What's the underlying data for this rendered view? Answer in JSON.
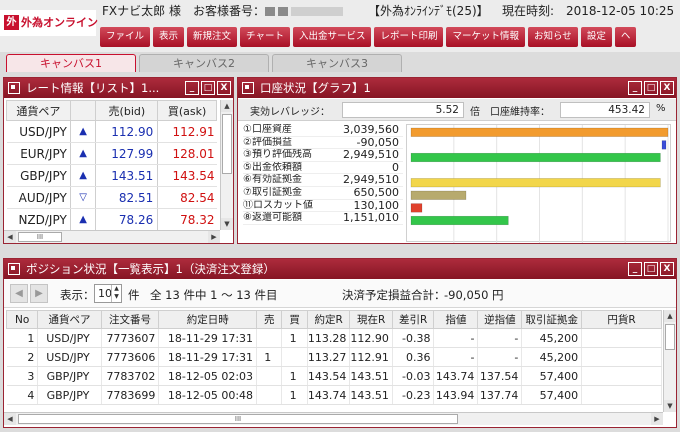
{
  "header": {
    "logo_mark": "外",
    "logo_text": "外為オンライン",
    "user_label": "FXナビ太郎 様　お客様番号：",
    "app_title": "【外為ｵﾝﾗｲﾝﾃﾞﾓ(25)】",
    "clock_label": "現在時刻:",
    "clock_value": "2018-12-05 10:25"
  },
  "menu": [
    "ファイル",
    "表示",
    "新規注文",
    "チャート",
    "入出金サービス",
    "レポート印刷",
    "マーケット情報",
    "お知らせ",
    "設定",
    "ヘ"
  ],
  "tabs": [
    "キャンバス1",
    "キャンバス2",
    "キャンバス3"
  ],
  "window_controls": {
    "minimize": "_",
    "maximize": "□",
    "close": "X"
  },
  "rate_panel": {
    "title": "レート情報【リスト】1...",
    "columns": [
      "通貨ペア",
      "",
      "売(bid)",
      "買(ask)"
    ],
    "rows": [
      {
        "pair": "USD/JPY",
        "arrow": "▲",
        "bid": "112.90",
        "ask": "112.91"
      },
      {
        "pair": "EUR/JPY",
        "arrow": "▲",
        "bid": "127.99",
        "ask": "128.01"
      },
      {
        "pair": "GBP/JPY",
        "arrow": "▲",
        "bid": "143.51",
        "ask": "143.54"
      },
      {
        "pair": "AUD/JPY",
        "arrow": "▽",
        "bid": "82.51",
        "ask": "82.54"
      },
      {
        "pair": "NZD/JPY",
        "arrow": "▲",
        "bid": "78.26",
        "ask": "78.32"
      }
    ],
    "scroll_thumb": "III"
  },
  "account_panel": {
    "title": "口座状況【グラフ】1",
    "leverage_label": "実効レバレッジ：",
    "leverage_value": "5.52",
    "leverage_unit": "倍",
    "margin_label": "口座維持率：",
    "margin_value": "453.42",
    "margin_unit": "%",
    "rows": [
      {
        "label": "①口座資産",
        "value": "3,039,560",
        "bar": 3039560,
        "color": "#f29b2e"
      },
      {
        "label": "②評価損益",
        "value": "-90,050",
        "bar": -90050,
        "color": "#3b4ed8"
      },
      {
        "label": "③預り評価残高",
        "value": "2,949,510",
        "bar": 2949510,
        "color": "#33c64a"
      },
      {
        "label": "⑤出金依頼額",
        "value": "0",
        "bar": 0,
        "color": "#cccccc"
      },
      {
        "label": "⑥有効証拠金",
        "value": "2,949,510",
        "bar": 2949510,
        "color": "#f2d64a"
      },
      {
        "label": "⑦取引証拠金",
        "value": "650,500",
        "bar": 650500,
        "color": "#b7aa6e"
      },
      {
        "label": "⑪ロスカット値",
        "value": "130,100",
        "bar": 130100,
        "color": "#e0422e"
      },
      {
        "label": "⑧返還可能額",
        "value": "1,151,010",
        "bar": 1151010,
        "color": "#33c64a"
      }
    ]
  },
  "chart_data": {
    "type": "bar",
    "orientation": "horizontal",
    "categories": [
      "①口座資産",
      "②評価損益",
      "③預り評価残高",
      "⑤出金依頼額",
      "⑥有効証拠金",
      "⑦取引証拠金",
      "⑪ロスカット値",
      "⑧返還可能額"
    ],
    "values": [
      3039560,
      -90050,
      2949510,
      0,
      2949510,
      650500,
      130100,
      1151010
    ],
    "xlim": [
      0,
      3039560
    ],
    "grid": true
  },
  "position_panel": {
    "title": "ポジション状況【一覧表示】1（決済注文登録）",
    "nav_prev": "◀",
    "nav_next": "▶",
    "display_label": "表示：",
    "page_size": "10",
    "page_unit": "件",
    "range_text": "全 13 件中 1 ～ 13 件目",
    "pl_label": "決済予定損益合計：",
    "pl_value": "-90,050 円",
    "columns": [
      "No",
      "通貨ペア",
      "注文番号",
      "約定日時",
      "売",
      "買",
      "約定R",
      "現在R",
      "差引R",
      "指値",
      "逆指値",
      "取引証拠金",
      "円貨R"
    ],
    "rows": [
      [
        "1",
        "USD/JPY",
        "7773607",
        "18-11-29 17:31",
        "",
        "1",
        "113.28",
        "112.90",
        "-0.38",
        "-",
        "-",
        "45,200",
        ""
      ],
      [
        "2",
        "USD/JPY",
        "7773606",
        "18-11-29 17:31",
        "1",
        "",
        "113.27",
        "112.91",
        "0.36",
        "-",
        "-",
        "45,200",
        ""
      ],
      [
        "3",
        "GBP/JPY",
        "7783702",
        "18-12-05 02:03",
        "",
        "1",
        "143.54",
        "143.51",
        "-0.03",
        "143.74",
        "137.54",
        "57,400",
        ""
      ],
      [
        "4",
        "GBP/JPY",
        "7783699",
        "18-12-05 00:48",
        "",
        "1",
        "143.74",
        "143.51",
        "-0.23",
        "143.94",
        "137.74",
        "57,400",
        ""
      ]
    ],
    "scroll_thumb": "III"
  }
}
